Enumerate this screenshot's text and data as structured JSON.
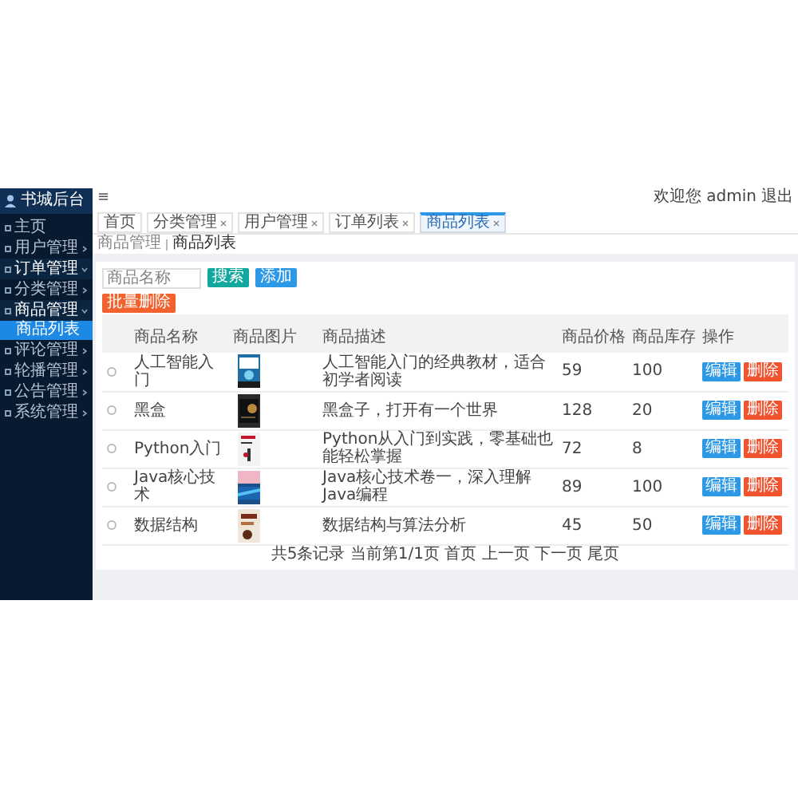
{
  "sidebar": {
    "title": "书城后台",
    "items": [
      {
        "label": "主页",
        "expanded": false,
        "has_arrow": false
      },
      {
        "label": "用户管理",
        "expanded": false,
        "has_arrow": true
      },
      {
        "label": "订单管理",
        "expanded": true,
        "has_arrow": true
      },
      {
        "label": "分类管理",
        "expanded": false,
        "has_arrow": true
      },
      {
        "label": "商品管理",
        "expanded": true,
        "has_arrow": true,
        "children": [
          {
            "label": "商品列表",
            "selected": true
          }
        ]
      },
      {
        "label": "评论管理",
        "expanded": false,
        "has_arrow": true
      },
      {
        "label": "轮播管理",
        "expanded": false,
        "has_arrow": true
      },
      {
        "label": "公告管理",
        "expanded": false,
        "has_arrow": true
      },
      {
        "label": "系统管理",
        "expanded": false,
        "has_arrow": true
      }
    ]
  },
  "header": {
    "menu_icon": "≡",
    "user": "欢迎您 admin",
    "logout": "退出"
  },
  "tabs": [
    {
      "label": "首页",
      "selected": false,
      "closable": false
    },
    {
      "label": "分类管理",
      "selected": false,
      "closable": true
    },
    {
      "label": "用户管理",
      "selected": false,
      "closable": true
    },
    {
      "label": "订单列表",
      "selected": false,
      "closable": true
    },
    {
      "label": "商品列表",
      "selected": true,
      "closable": true
    }
  ],
  "breadcrumb": [
    "商品管理",
    "商品列表"
  ],
  "search": {
    "placeholder": "商品名称",
    "search_button": "搜索",
    "add_button": "添加"
  },
  "batch_delete": "批量删除",
  "table": {
    "columns": [
      "",
      "商品名称",
      "商品图片",
      "商品描述",
      "商品价格",
      "商品库存",
      "操作"
    ],
    "rows": [
      {
        "checked": false,
        "name": "人工智能入门",
        "description": "人工智能入门的经典教材，适合初学者阅读",
        "price": "59",
        "stock": "100",
        "actions": [
          "编辑",
          "删除"
        ]
      },
      {
        "checked": false,
        "name": "黑盒",
        "description": "黑盒子，打开有一个世界",
        "price": "128",
        "stock": "20",
        "actions": [
          "编辑",
          "删除"
        ]
      },
      {
        "checked": false,
        "name": "Python入门",
        "description": "Python从入门到实践，零基础也能轻松掌握",
        "price": "72",
        "stock": "8",
        "actions": [
          "编辑",
          "删除"
        ]
      },
      {
        "checked": false,
        "name": "Java核心技术",
        "description": "Java核心技术卷一，深入理解Java编程",
        "price": "89",
        "stock": "100",
        "actions": [
          "编辑",
          "删除"
        ]
      },
      {
        "checked": false,
        "name": "数据结构",
        "description": "数据结构与算法分析",
        "price": "45",
        "stock": "50",
        "actions": [
          "编辑",
          "删除"
        ]
      }
    ]
  },
  "pagination": "共5条记录 当前第1/1页 首页 上一页 下一页 尾页"
}
